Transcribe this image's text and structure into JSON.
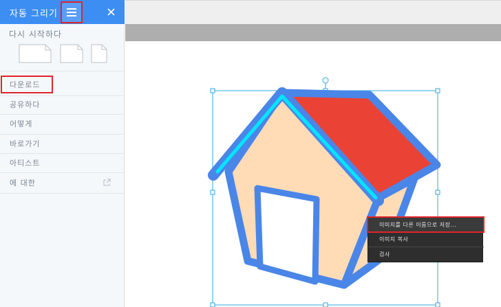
{
  "sidebar": {
    "title": "자동 그리기",
    "section_title": "다시 시작하다",
    "items": [
      {
        "label": "다운로드"
      },
      {
        "label": "공유하다"
      },
      {
        "label": "어떻게"
      },
      {
        "label": "바로가기"
      },
      {
        "label": "아티스트"
      },
      {
        "label": "에 대한"
      }
    ],
    "icons": {
      "menu": "menu-icon",
      "close": "close-icon",
      "external": "external-link-icon"
    }
  },
  "context_menu": {
    "items": [
      {
        "label": "이미지를 다른 이름으로 저장..."
      },
      {
        "label": "이미지 복사"
      },
      {
        "label": "검사"
      }
    ]
  },
  "colors": {
    "header_blue": "#3c8ef3",
    "highlight_red": "#e0242b",
    "house_outline": "#4a86e8",
    "house_wall": "#ffdcb5",
    "roof": "#ea4335",
    "roof_edge": "#00e5ff",
    "selection": "#29a8e0"
  }
}
